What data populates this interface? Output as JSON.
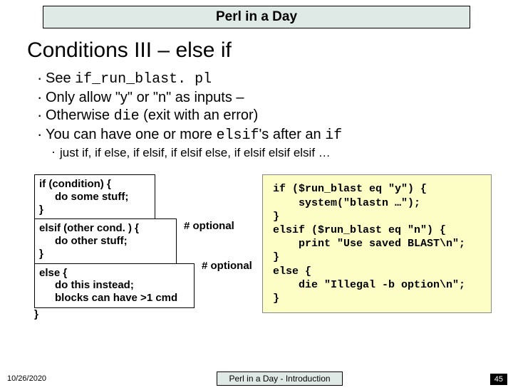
{
  "titleBar": "Perl in a Day",
  "heading": "Conditions III – else if",
  "bullets": {
    "b0a": "See ",
    "b0b": "if_run_blast. pl",
    "b1": "Only allow \"y\" or \"n\" as inputs –",
    "b2a": "Otherwise ",
    "b2b": "die",
    "b2c": " (exit with an error)",
    "b3a": "You can have one or more ",
    "b3b": "elsif",
    "b3c": "'s after an ",
    "b3d": "if"
  },
  "subbullet": "just if, if else, if elsif, if elsif else, if elsif elsif elsif …",
  "pseudo": {
    "box1l1": "if (condition) {",
    "box1l2": "do some stuff;",
    "box1l3": "}",
    "box2l1": "elsif (other cond. ) {",
    "box2l2": "do other stuff;",
    "box2l3": "}",
    "box3l1": "else {",
    "box3l2": "do this instead;",
    "box3l3": "blocks can have >1 cmd",
    "close": "}",
    "opt": "# optional"
  },
  "code": "if ($run_blast eq \"y\") {\n    system(\"blastn …\");\n}\nelsif ($run_blast eq \"n\") {\n    print \"Use saved BLAST\\n\";\n}\nelse {\n    die \"Illegal -b option\\n\";\n}",
  "footer": {
    "date": "10/26/2020",
    "center": "Perl in a Day - Introduction",
    "page": "45"
  }
}
